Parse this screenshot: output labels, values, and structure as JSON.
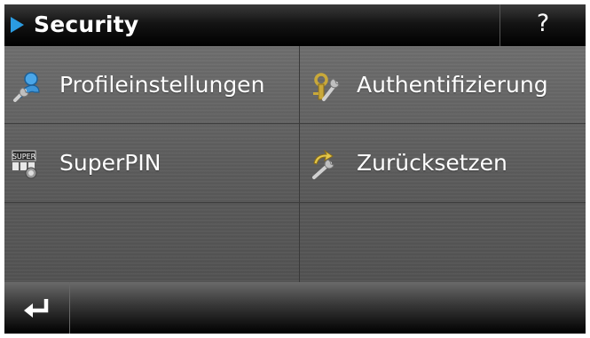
{
  "header": {
    "title": "Security",
    "help_label": "?"
  },
  "menu": {
    "items": [
      {
        "label": "Profileinstellungen",
        "icon": "user-settings-icon"
      },
      {
        "label": "Authentifizierung",
        "icon": "key-wrench-icon"
      },
      {
        "label": "SuperPIN",
        "icon": "superpin-icon",
        "icon_text": "SUPER"
      },
      {
        "label": "Zurücksetzen",
        "icon": "reset-wrench-icon"
      }
    ]
  },
  "footer": {
    "back_icon": "back-enter-icon"
  },
  "colors": {
    "accent": "#2b9be0",
    "header_bg": "#000000",
    "tile_bg": "#5f5f5f",
    "text": "#ffffff"
  }
}
